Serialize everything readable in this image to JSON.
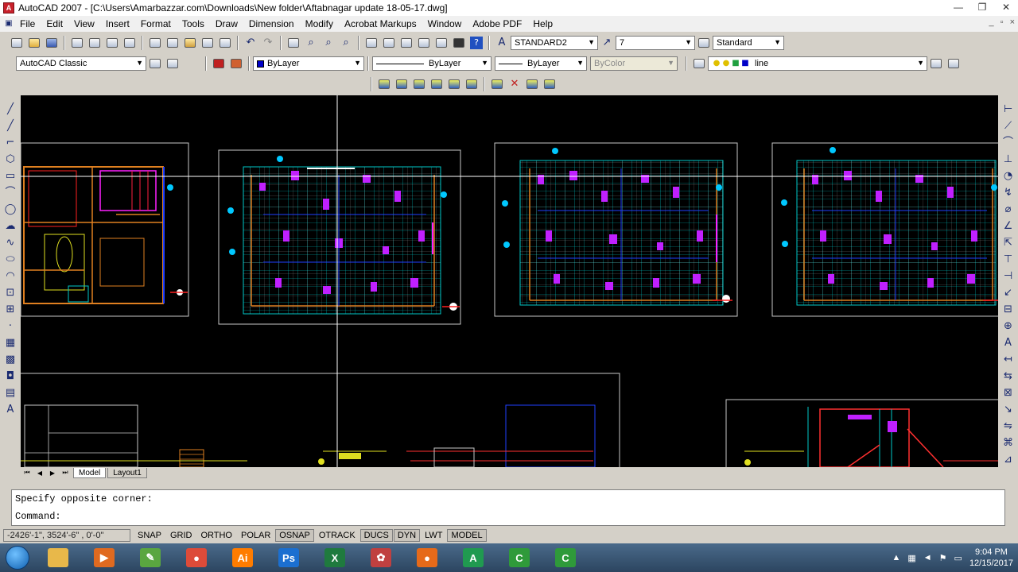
{
  "window": {
    "title": "AutoCAD 2007 - [C:\\Users\\Amarbazzar.com\\Downloads\\New folder\\Aftabnagar update 18-05-17.dwg]",
    "controls": [
      "—",
      "❐",
      "✕"
    ],
    "mdi_controls": [
      "_",
      "▫",
      "×"
    ]
  },
  "menu": [
    "File",
    "Edit",
    "View",
    "Insert",
    "Format",
    "Tools",
    "Draw",
    "Dimension",
    "Modify",
    "Acrobat Markups",
    "Window",
    "Adobe PDF",
    "Help"
  ],
  "toolbar": {
    "text_style": "STANDARD2",
    "dim_style": "7",
    "table_style": "Standard",
    "workspace": "AutoCAD Classic",
    "color": "ByLayer",
    "linetype": "ByLayer",
    "lineweight": "ByLayer",
    "plotstyle": "ByColor",
    "layer": "line"
  },
  "tabs": {
    "model": "Model",
    "layout": "Layout1"
  },
  "command": {
    "history": "Specify opposite corner:",
    "prompt": "Command:"
  },
  "status": {
    "coords": "-2426'-1\", 3524'-6\" , 0'-0\"",
    "buttons": [
      {
        "label": "SNAP",
        "on": false
      },
      {
        "label": "GRID",
        "on": false
      },
      {
        "label": "ORTHO",
        "on": false
      },
      {
        "label": "POLAR",
        "on": false
      },
      {
        "label": "OSNAP",
        "on": true
      },
      {
        "label": "OTRACK",
        "on": false
      },
      {
        "label": "DUCS",
        "on": true
      },
      {
        "label": "DYN",
        "on": true
      },
      {
        "label": "LWT",
        "on": false
      },
      {
        "label": "MODEL",
        "on": true
      }
    ]
  },
  "taskbar": {
    "apps": [
      {
        "name": "file-explorer",
        "glyph": "",
        "color": "#e8b84a"
      },
      {
        "name": "media-player",
        "glyph": "▶",
        "color": "#e06a20"
      },
      {
        "name": "pen-app",
        "glyph": "✎",
        "color": "#5aa640"
      },
      {
        "name": "chrome",
        "glyph": "●",
        "color": "#dd4b39"
      },
      {
        "name": "illustrator",
        "glyph": "Ai",
        "color": "#ff7c00"
      },
      {
        "name": "photoshop",
        "glyph": "Ps",
        "color": "#1b6fd0"
      },
      {
        "name": "excel",
        "glyph": "X",
        "color": "#1f7a3e"
      },
      {
        "name": "paint",
        "glyph": "✿",
        "color": "#c04040"
      },
      {
        "name": "firefox",
        "glyph": "●",
        "color": "#e66a1a"
      },
      {
        "name": "autocad-2007",
        "glyph": "A",
        "color": "#209a50"
      },
      {
        "name": "camtasia-1",
        "glyph": "C",
        "color": "#2f9a3a"
      },
      {
        "name": "camtasia-2",
        "glyph": "C",
        "color": "#2f9a3a"
      }
    ],
    "time": "9:04 PM",
    "date": "12/15/2017"
  }
}
